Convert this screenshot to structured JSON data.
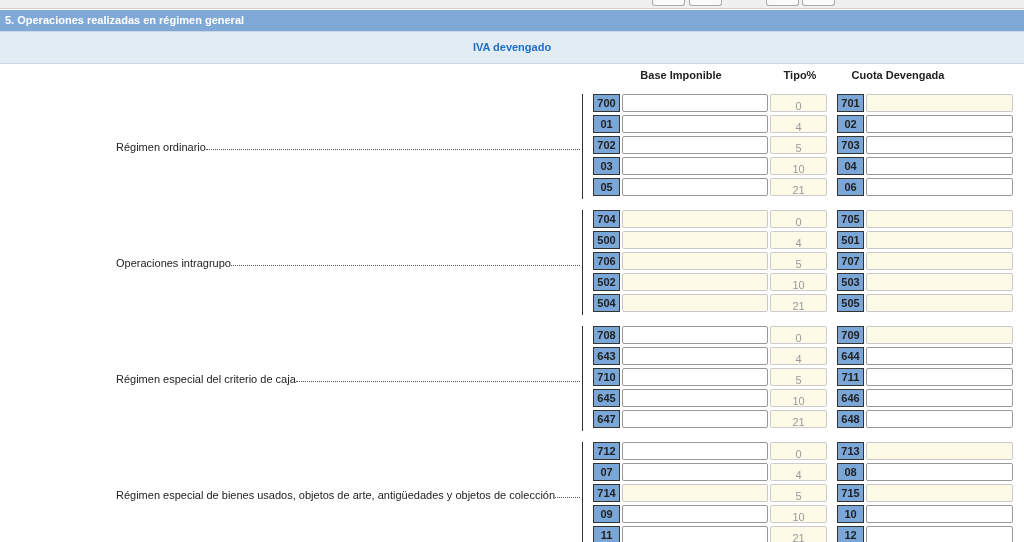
{
  "section_title": "5. Operaciones realizadas en régimen general",
  "subtitle": "IVA devengado",
  "columns": [
    "Base Imponible",
    "Tipo%",
    "Cuota Devengada"
  ],
  "groups": [
    {
      "label": "Régimen ordinario",
      "rows": [
        {
          "base_code": "700",
          "base_readonly": false,
          "tipo": "0",
          "cuota_code": "701",
          "cuota_readonly": true
        },
        {
          "base_code": "01",
          "base_readonly": false,
          "tipo": "4",
          "cuota_code": "02",
          "cuota_readonly": false
        },
        {
          "base_code": "702",
          "base_readonly": false,
          "tipo": "5",
          "cuota_code": "703",
          "cuota_readonly": false
        },
        {
          "base_code": "03",
          "base_readonly": false,
          "tipo": "10",
          "cuota_code": "04",
          "cuota_readonly": false
        },
        {
          "base_code": "05",
          "base_readonly": false,
          "tipo": "21",
          "cuota_code": "06",
          "cuota_readonly": false
        }
      ]
    },
    {
      "label": "Operaciones intragrupo",
      "rows": [
        {
          "base_code": "704",
          "base_readonly": true,
          "tipo": "0",
          "cuota_code": "705",
          "cuota_readonly": true
        },
        {
          "base_code": "500",
          "base_readonly": true,
          "tipo": "4",
          "cuota_code": "501",
          "cuota_readonly": true
        },
        {
          "base_code": "706",
          "base_readonly": true,
          "tipo": "5",
          "cuota_code": "707",
          "cuota_readonly": true
        },
        {
          "base_code": "502",
          "base_readonly": true,
          "tipo": "10",
          "cuota_code": "503",
          "cuota_readonly": true
        },
        {
          "base_code": "504",
          "base_readonly": true,
          "tipo": "21",
          "cuota_code": "505",
          "cuota_readonly": true
        }
      ]
    },
    {
      "label": "Régimen especial del criterio de caja",
      "rows": [
        {
          "base_code": "708",
          "base_readonly": false,
          "tipo": "0",
          "cuota_code": "709",
          "cuota_readonly": true
        },
        {
          "base_code": "643",
          "base_readonly": false,
          "tipo": "4",
          "cuota_code": "644",
          "cuota_readonly": false
        },
        {
          "base_code": "710",
          "base_readonly": false,
          "tipo": "5",
          "cuota_code": "711",
          "cuota_readonly": false
        },
        {
          "base_code": "645",
          "base_readonly": false,
          "tipo": "10",
          "cuota_code": "646",
          "cuota_readonly": false
        },
        {
          "base_code": "647",
          "base_readonly": false,
          "tipo": "21",
          "cuota_code": "648",
          "cuota_readonly": false
        }
      ]
    },
    {
      "label": "Régimen especial de bienes usados, objetos de arte, antigüedades y objetos de colección",
      "rows": [
        {
          "base_code": "712",
          "base_readonly": false,
          "tipo": "0",
          "cuota_code": "713",
          "cuota_readonly": true
        },
        {
          "base_code": "07",
          "base_readonly": false,
          "tipo": "4",
          "cuota_code": "08",
          "cuota_readonly": false
        },
        {
          "base_code": "714",
          "base_readonly": true,
          "tipo": "5",
          "cuota_code": "715",
          "cuota_readonly": true
        },
        {
          "base_code": "09",
          "base_readonly": false,
          "tipo": "10",
          "cuota_code": "10",
          "cuota_readonly": false
        },
        {
          "base_code": "11",
          "base_readonly": false,
          "tipo": "21",
          "cuota_code": "12",
          "cuota_readonly": false
        }
      ]
    }
  ]
}
